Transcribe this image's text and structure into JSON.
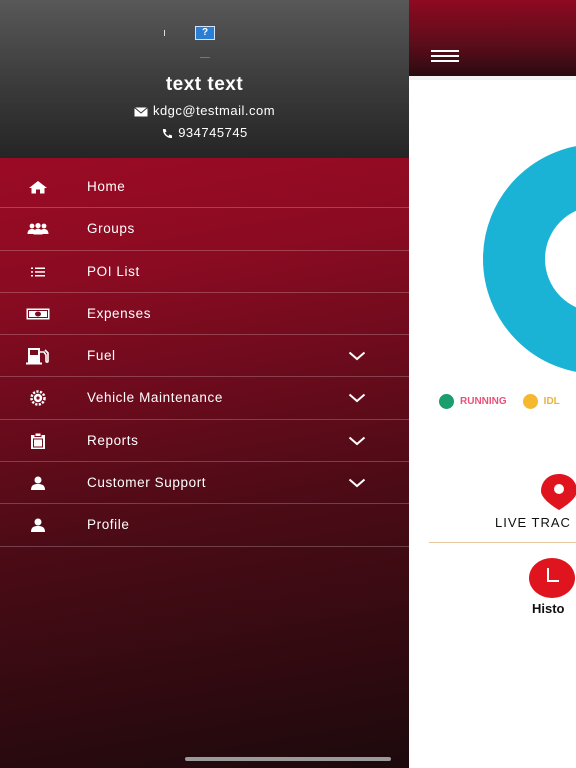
{
  "drawer": {
    "user": {
      "avatar_glyph": "?",
      "name": "text text",
      "email": "kdgc@testmail.com",
      "phone": "934745745"
    },
    "menu": [
      {
        "label": "Home",
        "icon": "home-icon",
        "has_chevron": false
      },
      {
        "label": "Groups",
        "icon": "groups-icon",
        "has_chevron": false
      },
      {
        "label": "POI List",
        "icon": "list-icon",
        "has_chevron": false
      },
      {
        "label": "Expenses",
        "icon": "cash-icon",
        "has_chevron": false
      },
      {
        "label": "Fuel",
        "icon": "fuel-pump-icon",
        "has_chevron": true
      },
      {
        "label": "Vehicle Maintenance",
        "icon": "gear-icon",
        "has_chevron": true
      },
      {
        "label": "Reports",
        "icon": "clipboard-icon",
        "has_chevron": true
      },
      {
        "label": "Customer Support",
        "icon": "user-icon",
        "has_chevron": true
      },
      {
        "label": "Profile",
        "icon": "user-icon",
        "has_chevron": false
      }
    ]
  },
  "app": {
    "legend": [
      {
        "label": "RUNNING",
        "color": "#1a9e6e"
      },
      {
        "label": "IDL",
        "color": "#f5b82e"
      }
    ],
    "donut_color": "#1ab3d6",
    "live_tracking_label": "LIVE TRAC",
    "history_label": "Histo",
    "accent": "#e0141e"
  }
}
